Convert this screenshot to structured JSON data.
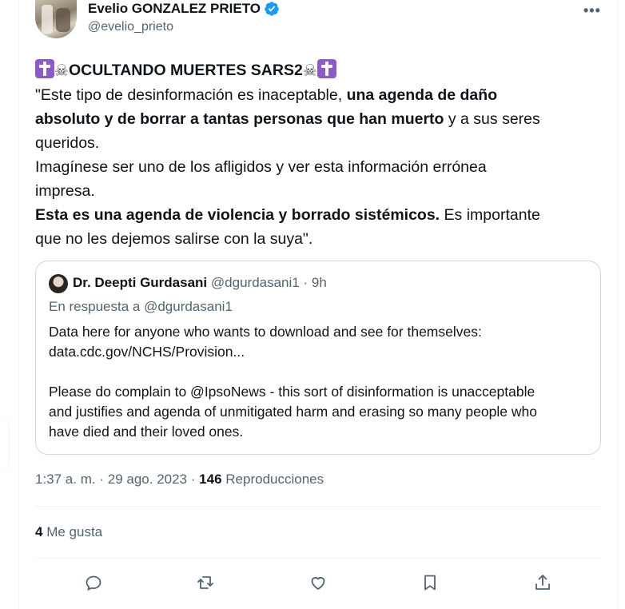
{
  "author": {
    "name": "Evelio GONZALEZ PRIETO",
    "handle": "@evelio_prieto",
    "verified": true
  },
  "tweet": {
    "title": "OCULTANDO MUERTES SARS2",
    "lines": [
      {
        "pre": "\"Este tipo de desinformación es inaceptable, ",
        "bold": "una agenda de daño",
        "post": ""
      },
      {
        "pre": "",
        "bold": "absoluto y de borrar a tantas personas que han muerto",
        "post": " y a sus seres"
      },
      {
        "pre": "queridos.",
        "bold": "",
        "post": ""
      },
      {
        "pre": "Imagínese ser uno de los afligidos y ver esta información errónea",
        "bold": "",
        "post": ""
      },
      {
        "pre": "impresa.",
        "bold": "",
        "post": ""
      },
      {
        "pre": "",
        "bold": "Esta es una agenda de violencia y borrado sistémicos.",
        "post": " Es importante"
      },
      {
        "pre": "que no les dejemos salirse con la suya\".",
        "bold": "",
        "post": ""
      }
    ]
  },
  "quote": {
    "name": "Dr. Deepti Gurdasani",
    "handle": "@dgurdasani1",
    "time": "9h",
    "reply_to": "En respuesta a @dgurdasani1",
    "para1": [
      "Data here for anyone who wants to download and see for themselves:",
      "data.cdc.gov/NCHS/Provision..."
    ],
    "para2": [
      "Please do complain to @IpsoNews - this sort of disinformation is unacceptable",
      "and justifies and agenda of unmitigated harm and erasing so many people who",
      "have died and their loved ones."
    ]
  },
  "meta": {
    "time": "1:37 a. m.",
    "date": "29 ago. 2023",
    "views": "146",
    "views_label": "Reproducciones"
  },
  "likes": {
    "count": "4",
    "label": "Me gusta"
  },
  "colors": {
    "text": "#0f1419",
    "secondary": "#536471",
    "border": "#cfd9de",
    "verified": "#1d9bf0",
    "cross": "#8c5bc6"
  }
}
